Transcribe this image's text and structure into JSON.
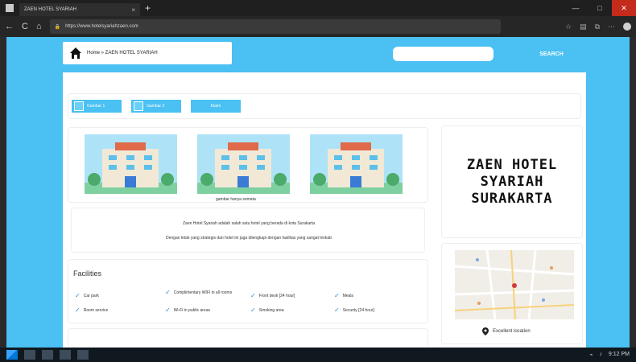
{
  "browser": {
    "tab_title": "ZAEN HOTEL SYARIAH",
    "tab_close": "×",
    "new_tab": "+",
    "url": "https://www.hotelsyariahzaen.com",
    "minimize": "—",
    "maximize": "□",
    "close": "✕",
    "nav_back": "←",
    "nav_forward": "→",
    "reload": "C",
    "home": "⌂"
  },
  "header": {
    "home_icon": "home-icon",
    "breadcrumb": "Home » ZAEN HOTEL SYARIAH",
    "search_placeholder": "",
    "search_button": "SEARCH"
  },
  "documents": {
    "btn1": "Gambar 1",
    "btn2": "Gambar 2",
    "btn3": "Klaim"
  },
  "gallery": {
    "images": [
      "hotel-image-1",
      "hotel-image-2",
      "hotel-image-3"
    ],
    "caption": "gambar hanya semata"
  },
  "description": {
    "line1": "Zaen Hotel Syariah adalah salah satu hotel yang berada di kota Surakarta",
    "line2": "Dengan letak yang strategis dan hotel ini juga dilengkapi dengan fasilitas yang sangat lenkab"
  },
  "facilities": {
    "title": "Facilities",
    "items": [
      "Car park",
      "Complimentary WIFI in all rooms",
      "Front desk [24 hour]",
      "Meals",
      "Room service",
      "Wi-Fi in public areas",
      "Smoking area",
      "Security [24 hour]"
    ]
  },
  "hotel": {
    "name_line1": "ZAEN HOTEL",
    "name_line2": "SYARIAH",
    "name_line3": "SURAKARTA",
    "location_label": "Excellent location"
  },
  "taskbar": {
    "clock": "9:12 PM"
  },
  "colors": {
    "accent": "#4ac0f3",
    "check": "#2a8bd0"
  }
}
